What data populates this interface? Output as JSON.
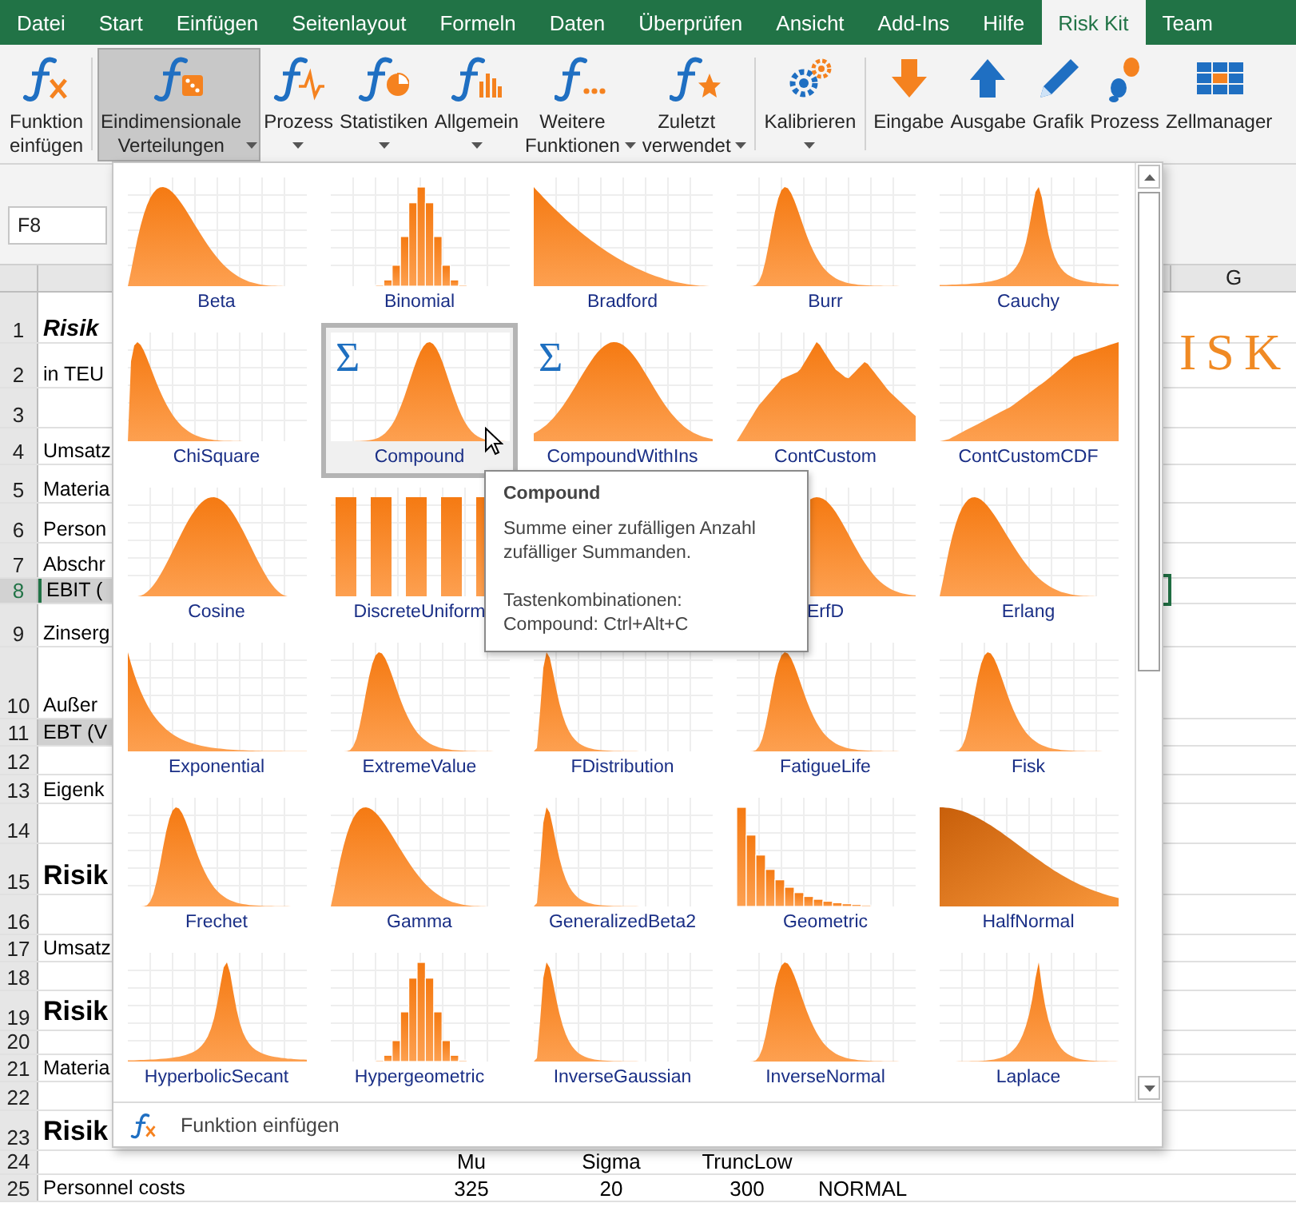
{
  "menu_tabs": [
    {
      "label": "Datei",
      "selected": false
    },
    {
      "label": "Start",
      "selected": false
    },
    {
      "label": "Einfügen",
      "selected": false
    },
    {
      "label": "Seitenlayout",
      "selected": false
    },
    {
      "label": "Formeln",
      "selected": false
    },
    {
      "label": "Daten",
      "selected": false
    },
    {
      "label": "Überprüfen",
      "selected": false
    },
    {
      "label": "Ansicht",
      "selected": false
    },
    {
      "label": "Add-Ins",
      "selected": false
    },
    {
      "label": "Hilfe",
      "selected": false
    },
    {
      "label": "Risk Kit",
      "selected": true
    },
    {
      "label": "Team",
      "selected": false
    }
  ],
  "ribbon": {
    "groups": [
      [
        {
          "label": "Funktion einfügen",
          "kind": "stacked",
          "selected": false,
          "dropdown": false
        }
      ],
      [
        {
          "label": "Eindimensionale Verteilungen",
          "kind": "stacked",
          "selected": true,
          "dropdown": true
        },
        {
          "label": "Prozess",
          "kind": "single",
          "selected": false,
          "dropdown": true
        },
        {
          "label": "Statistiken",
          "kind": "single",
          "selected": false,
          "dropdown": true
        },
        {
          "label": "Allgemein",
          "kind": "single",
          "selected": false,
          "dropdown": true
        },
        {
          "label": "Weitere Funktionen",
          "kind": "stacked",
          "selected": false,
          "dropdown": true
        },
        {
          "label": "Zuletzt verwendet",
          "kind": "stacked",
          "selected": false,
          "dropdown": true
        }
      ],
      [
        {
          "label": "Kalibrieren",
          "kind": "single",
          "selected": false,
          "dropdown": true
        }
      ],
      [
        {
          "label": "Eingabe",
          "kind": "single",
          "selected": false,
          "dropdown": false
        },
        {
          "label": "Ausgabe",
          "kind": "single",
          "selected": false,
          "dropdown": false
        },
        {
          "label": "Grafik",
          "kind": "single",
          "selected": false,
          "dropdown": false
        },
        {
          "label": "Prozess",
          "kind": "single",
          "selected": false,
          "dropdown": false
        },
        {
          "label": "Zellmanager",
          "kind": "single",
          "selected": false,
          "dropdown": false
        }
      ]
    ]
  },
  "name_box": "F8",
  "column_header": "G",
  "rows": [
    {
      "number": "1",
      "text": "Risik",
      "kind": "title",
      "selected": false
    },
    {
      "number": "2",
      "text": "in TEU",
      "kind": "plain",
      "selected": false
    },
    {
      "number": "3",
      "kind": "plain",
      "selected": false
    },
    {
      "number": "4",
      "text": "Umsatz",
      "kind": "plain",
      "selected": false
    },
    {
      "number": "5",
      "text": "Materia",
      "kind": "plain",
      "selected": false
    },
    {
      "number": "6",
      "text": "Person",
      "kind": "plain",
      "selected": false
    },
    {
      "number": "7",
      "text": "Abschr",
      "kind": "plain",
      "selected": false
    },
    {
      "number": "8",
      "text": "EBIT (",
      "kind": "shaded",
      "selected": true
    },
    {
      "number": "9",
      "text": "Zinserg",
      "kind": "plain",
      "selected": false
    },
    {
      "number": "10",
      "text": "Außer",
      "kind": "plain",
      "selected": false
    },
    {
      "number": "11",
      "text": "EBT (V",
      "kind": "shaded",
      "selected": false
    },
    {
      "number": "12",
      "kind": "plain",
      "selected": false
    },
    {
      "number": "13",
      "text": "Eigenk",
      "kind": "plain",
      "selected": false
    },
    {
      "number": "14",
      "kind": "plain",
      "selected": false
    },
    {
      "number": "15",
      "text": "Risik",
      "kind": "heading",
      "selected": false
    },
    {
      "number": "16",
      "kind": "plain",
      "selected": false
    },
    {
      "number": "17",
      "text": "Umsatz",
      "kind": "plain",
      "selected": false
    },
    {
      "number": "18",
      "kind": "plain",
      "selected": false
    },
    {
      "number": "19",
      "text": "Risik",
      "kind": "heading",
      "selected": false
    },
    {
      "number": "20",
      "kind": "plain",
      "selected": false
    },
    {
      "number": "21",
      "text": "Materia",
      "kind": "plain",
      "selected": false
    },
    {
      "number": "22",
      "kind": "plain",
      "selected": false
    },
    {
      "number": "23",
      "text": "Risik",
      "kind": "heading",
      "selected": false
    },
    {
      "number": "24",
      "kind": "plain",
      "selected": false,
      "cells": [
        "Mu",
        "Sigma",
        "TruncLow"
      ]
    },
    {
      "number": "25",
      "text": "Personnel costs",
      "kind": "plain",
      "selected": false,
      "cells": [
        "325",
        "20",
        "300",
        "NORMAL"
      ]
    }
  ],
  "logo": "ISK",
  "dropdown": {
    "items": [
      {
        "label": "Beta",
        "kind": "beta",
        "selected": false
      },
      {
        "label": "Binomial",
        "kind": "bars",
        "selected": false
      },
      {
        "label": "Bradford",
        "kind": "decay",
        "selected": false
      },
      {
        "label": "Burr",
        "kind": "skew",
        "selected": false
      },
      {
        "label": "Cauchy",
        "kind": "peak",
        "selected": false
      },
      {
        "label": "ChiSquare",
        "kind": "chisq",
        "selected": false
      },
      {
        "label": "Compound",
        "kind": "sum",
        "symbol": "Σ",
        "selected": true
      },
      {
        "label": "CompoundWithIns",
        "kind": "sumwide",
        "symbol": "Σ",
        "selected": false
      },
      {
        "label": "ContCustom",
        "kind": "jagged",
        "selected": false
      },
      {
        "label": "ContCustomCDF",
        "kind": "cdf",
        "selected": false
      },
      {
        "label": "Cosine",
        "kind": "bell",
        "selected": false
      },
      {
        "label": "DiscreteUniform",
        "kind": "uniform",
        "selected": false
      },
      {
        "kind": "covered"
      },
      {
        "label": "ErfD",
        "kind": "erf",
        "selected": false
      },
      {
        "label": "Erlang",
        "kind": "beta",
        "selected": false
      },
      {
        "label": "Exponential",
        "kind": "expo",
        "selected": false
      },
      {
        "label": "ExtremeValue",
        "kind": "skew",
        "selected": false
      },
      {
        "label": "FDistribution",
        "kind": "spike",
        "selected": false
      },
      {
        "label": "FatigueLife",
        "kind": "skew",
        "selected": false
      },
      {
        "label": "Fisk",
        "kind": "skew",
        "selected": false
      },
      {
        "label": "Frechet",
        "kind": "skew",
        "selected": false
      },
      {
        "label": "Gamma",
        "kind": "beta",
        "selected": false
      },
      {
        "label": "GeneralizedBeta2",
        "kind": "spike",
        "selected": false
      },
      {
        "label": "Geometric",
        "kind": "steps",
        "selected": false
      },
      {
        "label": "HalfNormal",
        "kind": "half",
        "selected": false
      },
      {
        "label": "HyperbolicSecant",
        "kind": "peak",
        "selected": false
      },
      {
        "label": "Hypergeometric",
        "kind": "bars",
        "selected": false
      },
      {
        "label": "InverseGaussian",
        "kind": "spike",
        "selected": false
      },
      {
        "label": "InverseNormal",
        "kind": "skew",
        "selected": false
      },
      {
        "label": "Laplace",
        "kind": "cusp",
        "selected": false
      }
    ],
    "footer": "Funktion einfügen"
  },
  "tooltip": {
    "title": "Compound",
    "description": "Summe einer zufälligen Anzahl zufälliger Summanden.",
    "shortcut_heading": "Tastenkombinationen:",
    "shortcut": "Compound: Ctrl+Alt+C"
  }
}
